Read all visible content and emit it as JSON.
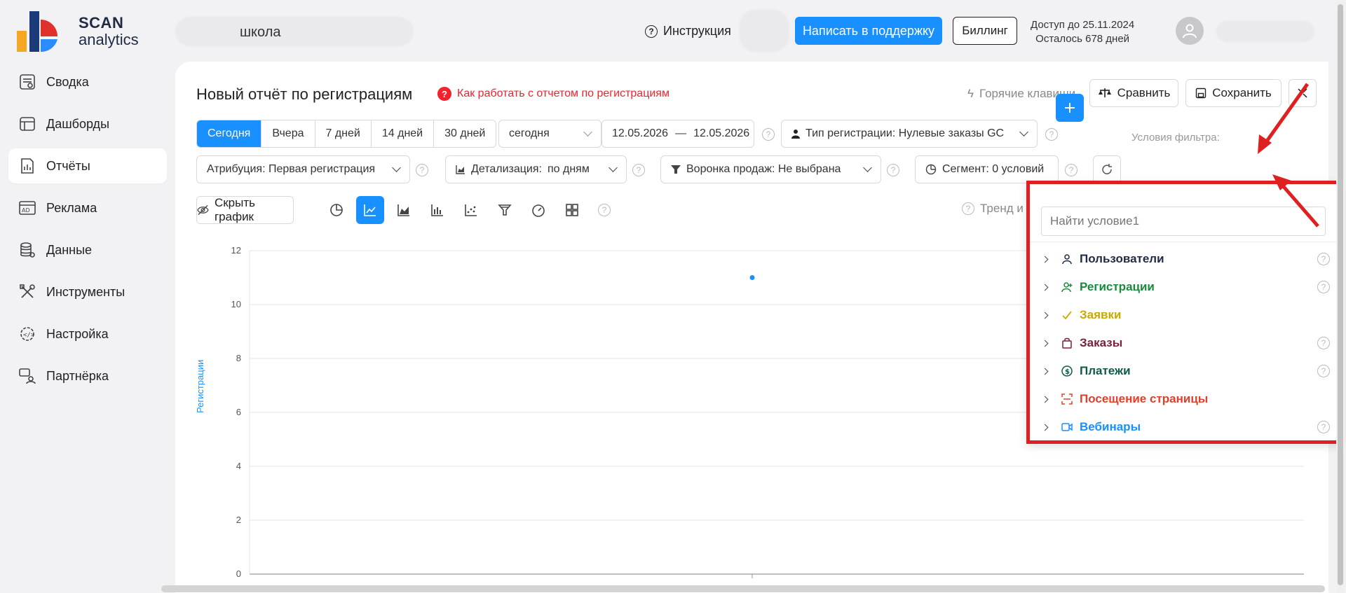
{
  "logo": {
    "brand_top": "SCAN",
    "brand_bottom": "analytics"
  },
  "header": {
    "project": "школа",
    "instruction": "Инструкция",
    "support_button": "Написать в поддержку",
    "billing_button": "Биллинг",
    "access_until": "Доступ до 25.11.2024",
    "days_left": "Осталось 678 дней"
  },
  "sidebar": {
    "items": [
      {
        "label": "Сводка",
        "icon": "summary-icon"
      },
      {
        "label": "Дашборды",
        "icon": "dashboard-icon"
      },
      {
        "label": "Отчёты",
        "icon": "reports-icon",
        "active": true
      },
      {
        "label": "Реклама",
        "icon": "ads-icon"
      },
      {
        "label": "Данные",
        "icon": "database-icon"
      },
      {
        "label": "Инструменты",
        "icon": "tools-icon"
      },
      {
        "label": "Настройка",
        "icon": "settings-icon"
      },
      {
        "label": "Партнёрка",
        "icon": "partner-icon"
      }
    ]
  },
  "report": {
    "title": "Новый отчёт по регистрациям",
    "howto": "Как работать с отчетом по регистрациям",
    "hotkeys": "Горячие клавиши",
    "compare": "Сравнить",
    "save": "Сохранить"
  },
  "periods": [
    "Сегодня",
    "Вчера",
    "7 дней",
    "14 дней",
    "30 дней"
  ],
  "period_select": "сегодня",
  "date_from": "12.05.2026",
  "date_sep": "—",
  "date_to": "12.05.2026",
  "reg_type": "Тип регистрации: Нулевые заказы GC",
  "attribution": "Атрибуция: Первая регистрация",
  "detail_label": "Детализация:",
  "detail_value": "по дням",
  "funnel": "Воронка продаж: Не выбрана",
  "segment": "Сегмент: 0 условий",
  "filter_label": "Условия фильтра:",
  "hide_chart": "Скрыть график",
  "trend": "Тренд и",
  "chart_data": {
    "type": "scatter",
    "ylabel": "Регистрации",
    "ylim": [
      0,
      12
    ],
    "yticks": [
      "12",
      "10",
      "8",
      "6",
      "4",
      "2",
      "0"
    ],
    "points": [
      {
        "x": "12.05.2026",
        "y": 11
      }
    ],
    "color": "#1890ff"
  },
  "dropdown": {
    "search_placeholder": "Найти условие1",
    "items": [
      {
        "label": "Пользователи",
        "color": "#1f2a44",
        "icon": "user-icon"
      },
      {
        "label": "Регистрации",
        "color": "#1a8a3a",
        "icon": "user-add-icon"
      },
      {
        "label": "Заявки",
        "color": "#c9a800",
        "icon": "check-icon"
      },
      {
        "label": "Заказы",
        "color": "#7a1f3d",
        "icon": "bag-icon"
      },
      {
        "label": "Платежи",
        "color": "#0f5a4a",
        "icon": "dollar-icon"
      },
      {
        "label": "Посещение страницы",
        "color": "#e0402a",
        "icon": "page-icon"
      },
      {
        "label": "Вебинары",
        "color": "#1890ff",
        "icon": "video-icon"
      }
    ]
  },
  "colors": {
    "accent": "#1890ff",
    "annotation": "#e02020"
  }
}
